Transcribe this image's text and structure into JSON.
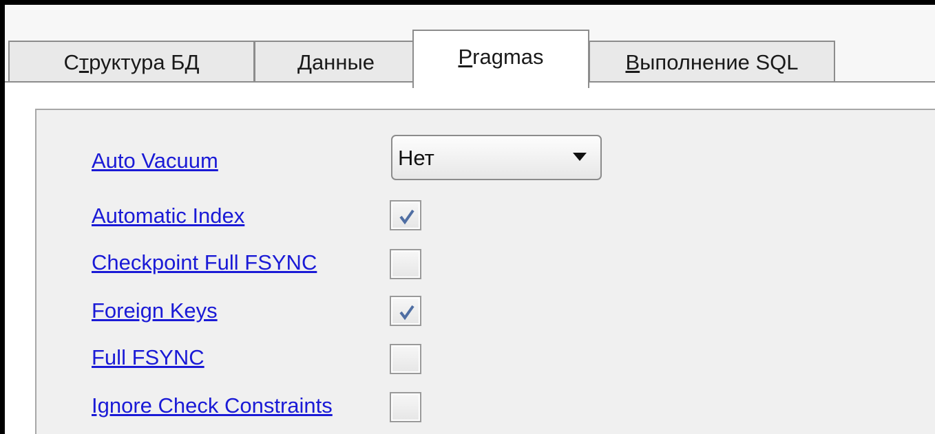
{
  "tabs": [
    {
      "pre": "С",
      "mnemonic": "т",
      "post": "руктура БД"
    },
    {
      "pre": "",
      "mnemonic": "Д",
      "post": "анные"
    },
    {
      "pre": "",
      "mnemonic": "P",
      "post": "ragmas"
    },
    {
      "pre": "",
      "mnemonic": "В",
      "post": "ыполнение SQL"
    }
  ],
  "active_tab": "Pragmas",
  "pragmas": {
    "auto_vacuum": {
      "label": "Auto Vacuum",
      "value": "Нет"
    },
    "automatic_index": {
      "label": "Automatic Index",
      "checked": true
    },
    "checkpoint_full_fsync": {
      "label": "Checkpoint Full FSYNC",
      "checked": false
    },
    "foreign_keys": {
      "label": "Foreign Keys",
      "checked": true
    },
    "full_fsync": {
      "label": "Full FSYNC",
      "checked": false
    },
    "ignore_check_constraints": {
      "label": "Ignore Check Constraints",
      "checked": false
    }
  },
  "icons": {
    "dropdown": "chevron-down-icon",
    "check": "check-icon"
  },
  "colors": {
    "link": "#1a1ad6",
    "check": "#4f6ea3"
  }
}
